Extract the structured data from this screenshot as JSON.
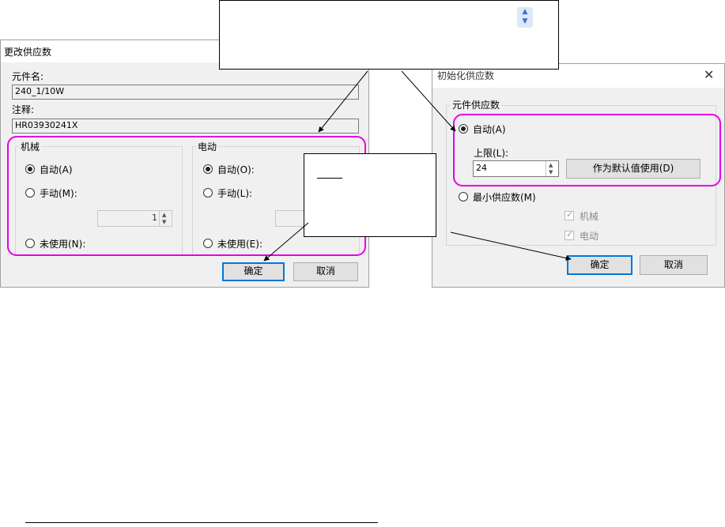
{
  "dialog_change": {
    "title": "更改供应数",
    "component_name_label": "元件名:",
    "component_name_value": "240_1/10W",
    "comment_label": "注释:",
    "comment_value": "HR03930241X",
    "mechanical_group": {
      "title": "机械",
      "auto": "自动(A)",
      "auto_selected": true,
      "manual": "手动(M):",
      "manual_value": "1",
      "unused": "未使用(N):"
    },
    "electric_group": {
      "title": "电动",
      "auto": "自动(O):",
      "auto_selected": true,
      "manual": "手动(L):",
      "unused": "未使用(E):"
    },
    "ok": "确定",
    "cancel": "取消"
  },
  "dialog_init": {
    "title": "初始化供应数",
    "group_title": "元件供应数",
    "auto": "自动(A)",
    "auto_selected": true,
    "upper_limit_label": "上限(L):",
    "upper_limit_value": "24",
    "use_default": "作为默认值使用(D)",
    "min_supply": "最小供应数(M)",
    "mechanical": "机械",
    "electric": "电动",
    "ok": "确定",
    "cancel": "取消"
  },
  "colors": {
    "highlight": "#e600e6",
    "accent": "#0078d7"
  },
  "icons": {
    "spin_updown": "chevron-updown-icon",
    "close": "close-icon"
  }
}
